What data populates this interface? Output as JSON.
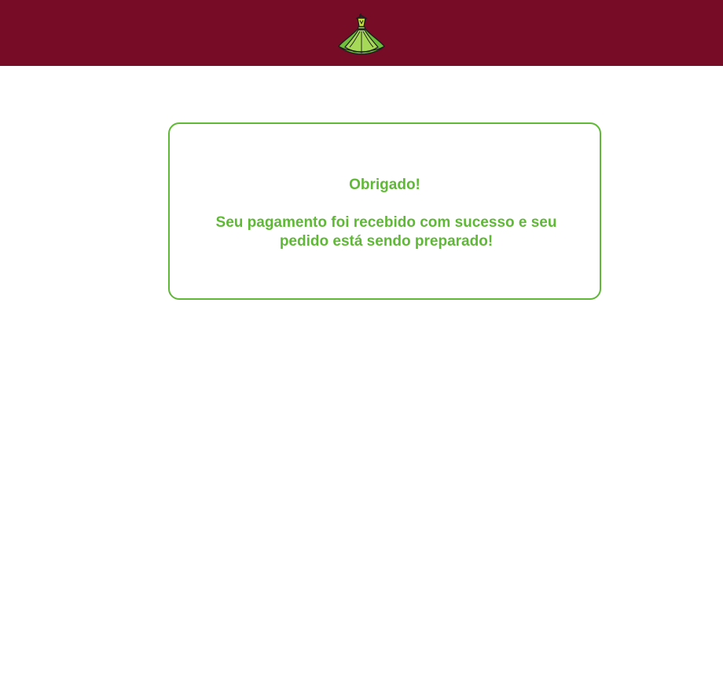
{
  "header": {
    "logo_icon": "green-dress-logo-icon",
    "background_color": "#770c27"
  },
  "confirmation": {
    "title": "Obrigado!",
    "message": "Seu pagamento foi recebido com sucesso e seu pedido está sendo preparado!",
    "accent_color": "#5fb936"
  }
}
